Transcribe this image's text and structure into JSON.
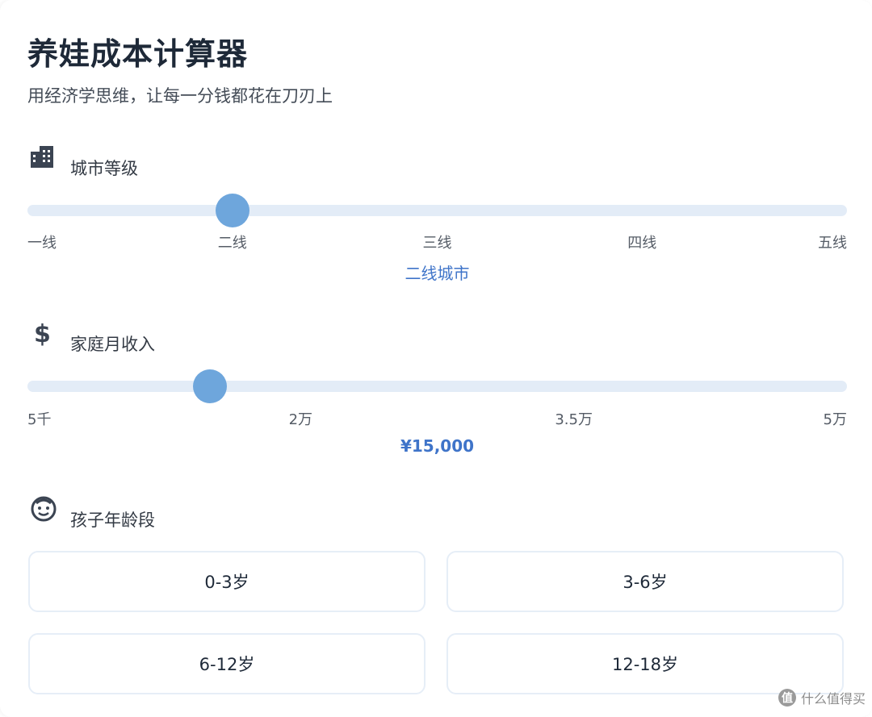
{
  "header": {
    "title": "养娃成本计算器",
    "subtitle": "用经济学思维，让每一分钱都花在刀刃上"
  },
  "city": {
    "label": "城市等级",
    "icon": "building-icon",
    "ticks": [
      "一线",
      "二线",
      "三线",
      "四线",
      "五线"
    ],
    "selected_index": 1,
    "value_text": "二线城市"
  },
  "income": {
    "label": "家庭月收入",
    "icon": "dollar-icon",
    "ticks": [
      "5千",
      "2万",
      "3.5万",
      "5万"
    ],
    "min": 5000,
    "max": 50000,
    "value": 15000,
    "value_text": "¥15,000"
  },
  "age": {
    "label": "孩子年龄段",
    "icon": "child-face-icon",
    "options": [
      "0-3岁",
      "3-6岁",
      "6-12岁",
      "12-18岁"
    ]
  },
  "watermark": {
    "badge": "值",
    "text": "什么值得买"
  },
  "colors": {
    "accent": "#3f74c9",
    "thumb": "#6ea6dc",
    "track": "#e3ecf7"
  }
}
